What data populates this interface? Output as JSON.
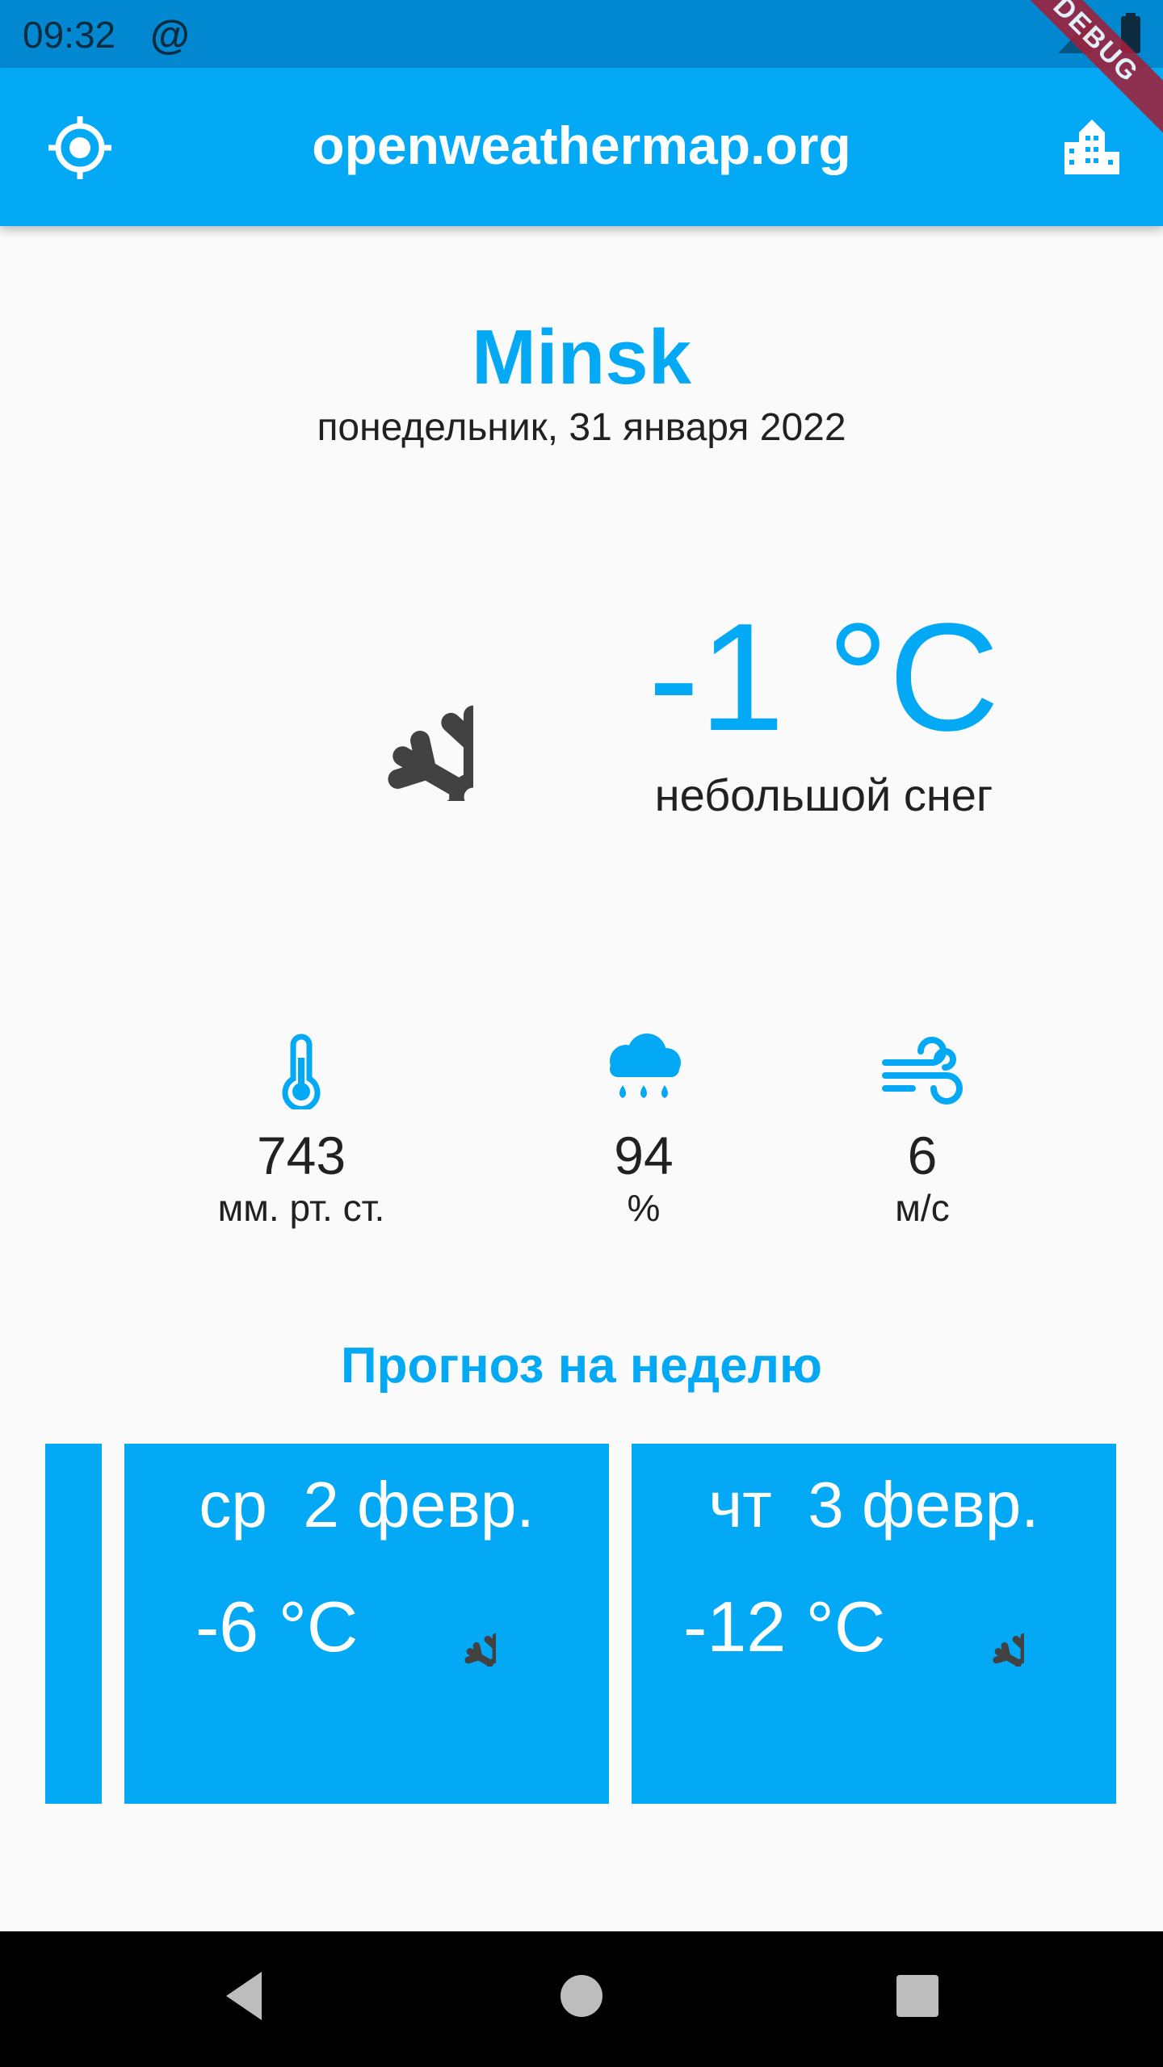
{
  "status_bar": {
    "time": "09:32",
    "at_icon": "@"
  },
  "app_bar": {
    "title": "openweathermap.org",
    "left_icon": "my-location-icon",
    "right_icon": "location-city-icon",
    "debug_label": "DEBUG"
  },
  "current": {
    "city": "Minsk",
    "date": "понедельник, 31 января 2022",
    "temperature": "-1 °C",
    "description": "небольшой снег",
    "icon": "snowflake-icon"
  },
  "stats": [
    {
      "icon": "thermometer-icon",
      "value": "743",
      "unit": "мм. рт. ст."
    },
    {
      "icon": "rain-cloud-icon",
      "value": "94",
      "unit": "%"
    },
    {
      "icon": "wind-icon",
      "value": "6",
      "unit": "м/с"
    }
  ],
  "forecast": {
    "title": "Прогноз на неделю",
    "days": [
      {
        "day": "ср  2 февр.",
        "temp": "-6 °C",
        "icon": "snowflake-icon"
      },
      {
        "day": "чт  3 февр.",
        "temp": "-12 °C",
        "icon": "snowflake-icon"
      }
    ]
  },
  "colors": {
    "accent": "#03a9f4",
    "status_bar": "#0288d1",
    "icon_dark": "#424242"
  }
}
